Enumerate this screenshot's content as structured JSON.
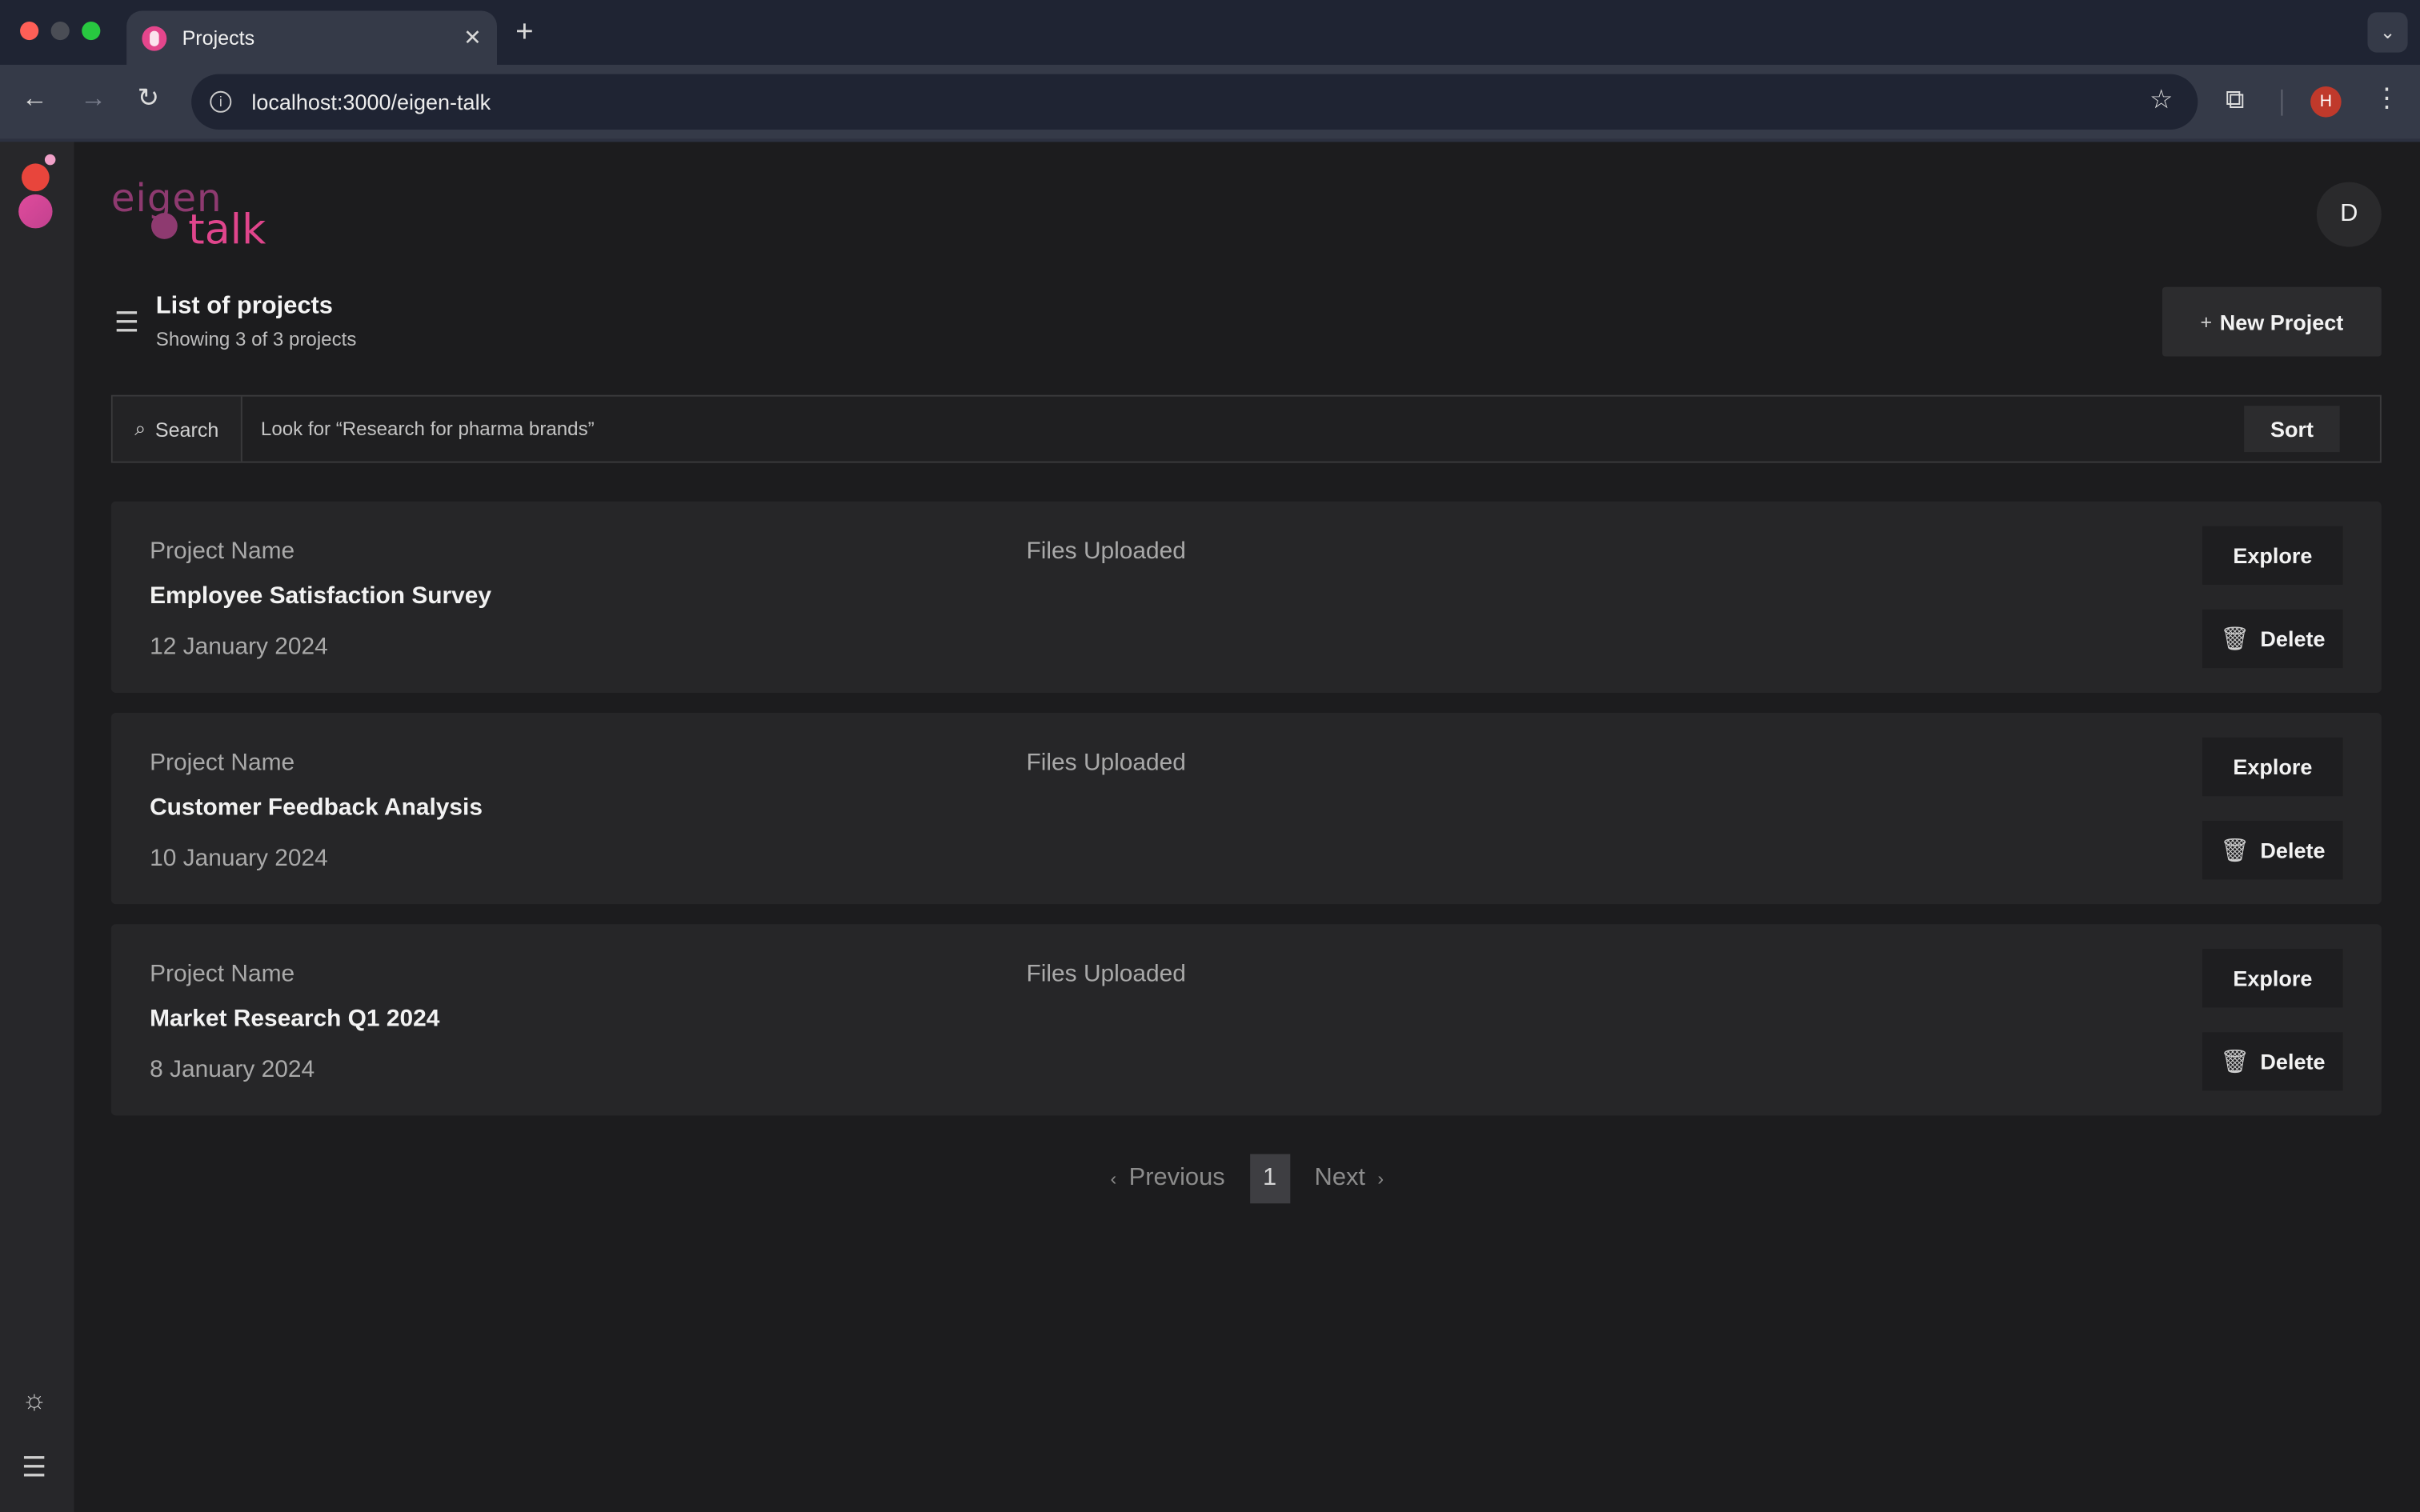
{
  "browser": {
    "tab_title": "Projects",
    "url": "localhost:3000/eigen-talk",
    "profile_initial": "H"
  },
  "app": {
    "logo_top": "eigen",
    "logo_bottom": "talk",
    "user_initial": "D"
  },
  "header": {
    "title": "List of projects",
    "subtitle": "Showing 3 of 3 projects",
    "new_project_label": "New Project"
  },
  "search": {
    "label": "Search",
    "placeholder": "Look for “Research for pharma brands”",
    "sort_label": "Sort"
  },
  "projects": [
    {
      "label": "Project Name",
      "name": "Employee Satisfaction Survey",
      "date": "12 January 2024",
      "files_label": "Files Uploaded",
      "explore_label": "Explore",
      "delete_label": "Delete"
    },
    {
      "label": "Project Name",
      "name": "Customer Feedback Analysis",
      "date": "10 January 2024",
      "files_label": "Files Uploaded",
      "explore_label": "Explore",
      "delete_label": "Delete"
    },
    {
      "label": "Project Name",
      "name": "Market Research Q1 2024",
      "date": "8 January 2024",
      "files_label": "Files Uploaded",
      "explore_label": "Explore",
      "delete_label": "Delete"
    }
  ],
  "pagination": {
    "previous_label": "Previous",
    "current_page": "1",
    "next_label": "Next"
  },
  "colors": {
    "brand_pink": "#e0458c",
    "brand_purple": "#8e3a70",
    "background": "#1c1c1e",
    "card": "#262628"
  }
}
